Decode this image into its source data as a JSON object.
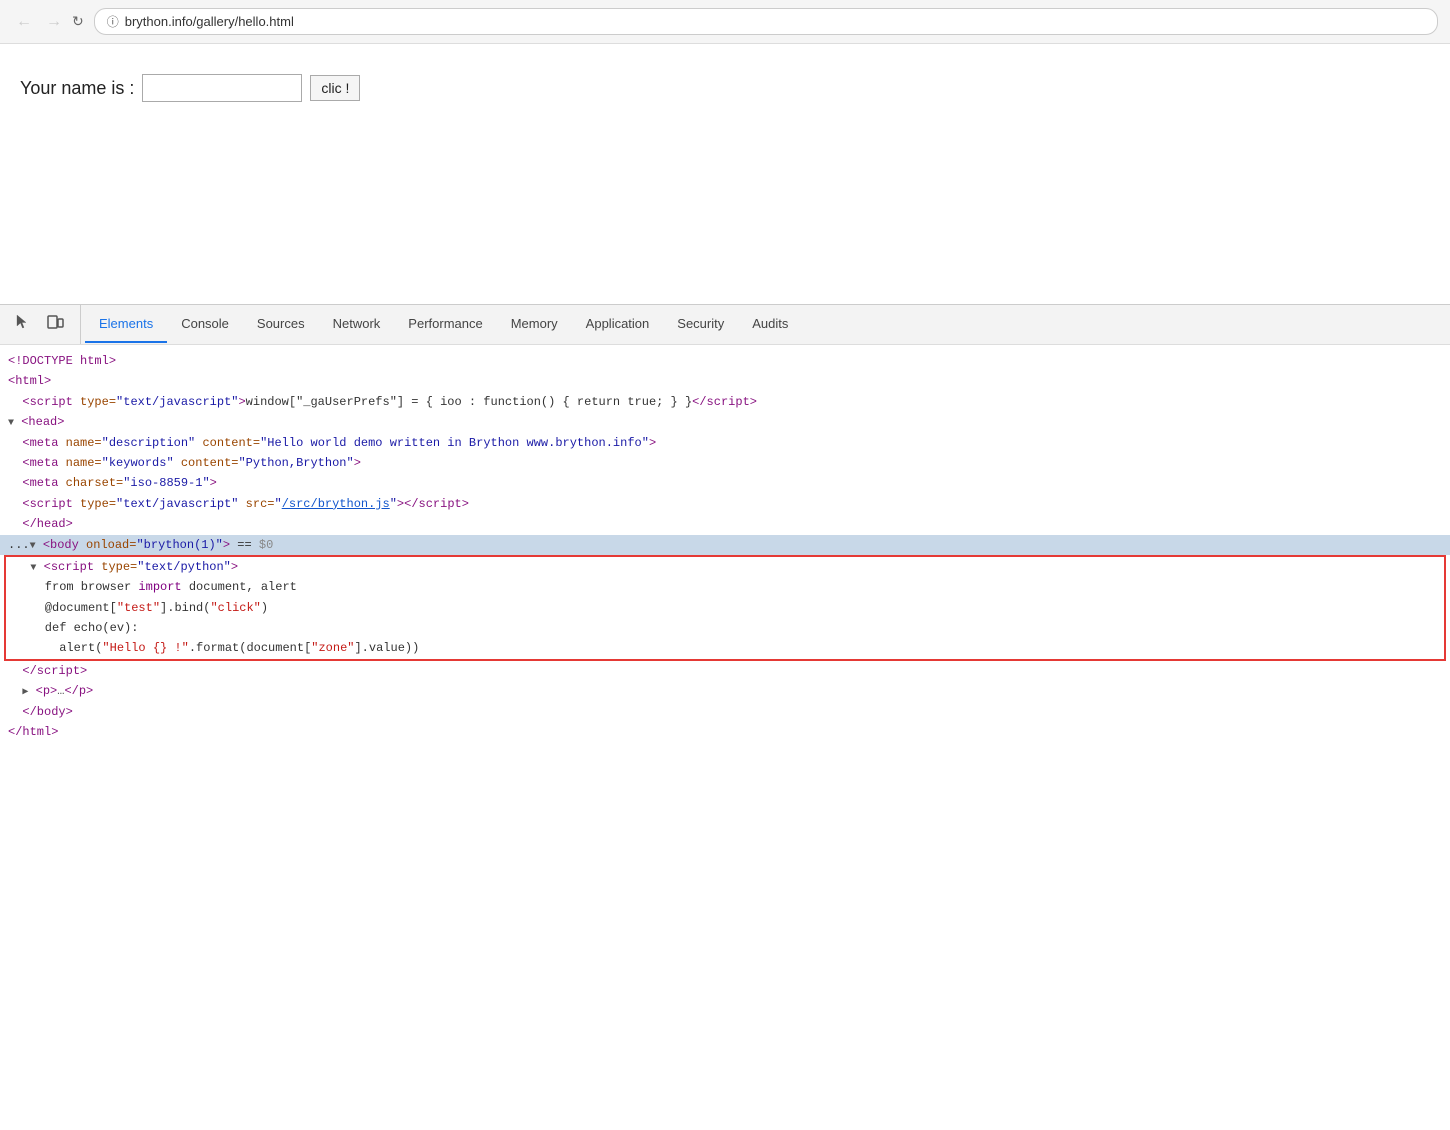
{
  "browser": {
    "back_disabled": true,
    "forward_disabled": true,
    "url_domain": "brython.info",
    "url_path": "/gallery/hello.html",
    "secure_label": "🔒"
  },
  "page": {
    "label": "Your name is :",
    "input_placeholder": "",
    "button_label": "clic !"
  },
  "devtools": {
    "tabs": [
      {
        "id": "elements",
        "label": "Elements",
        "active": true
      },
      {
        "id": "console",
        "label": "Console",
        "active": false
      },
      {
        "id": "sources",
        "label": "Sources",
        "active": false
      },
      {
        "id": "network",
        "label": "Network",
        "active": false
      },
      {
        "id": "performance",
        "label": "Performance",
        "active": false
      },
      {
        "id": "memory",
        "label": "Memory",
        "active": false
      },
      {
        "id": "application",
        "label": "Application",
        "active": false
      },
      {
        "id": "security",
        "label": "Security",
        "active": false
      },
      {
        "id": "audits",
        "label": "Audits",
        "active": false
      }
    ]
  },
  "icons": {
    "cursor": "⬡",
    "box": "⬜",
    "back": "←",
    "forward": "→",
    "reload": "↻"
  }
}
